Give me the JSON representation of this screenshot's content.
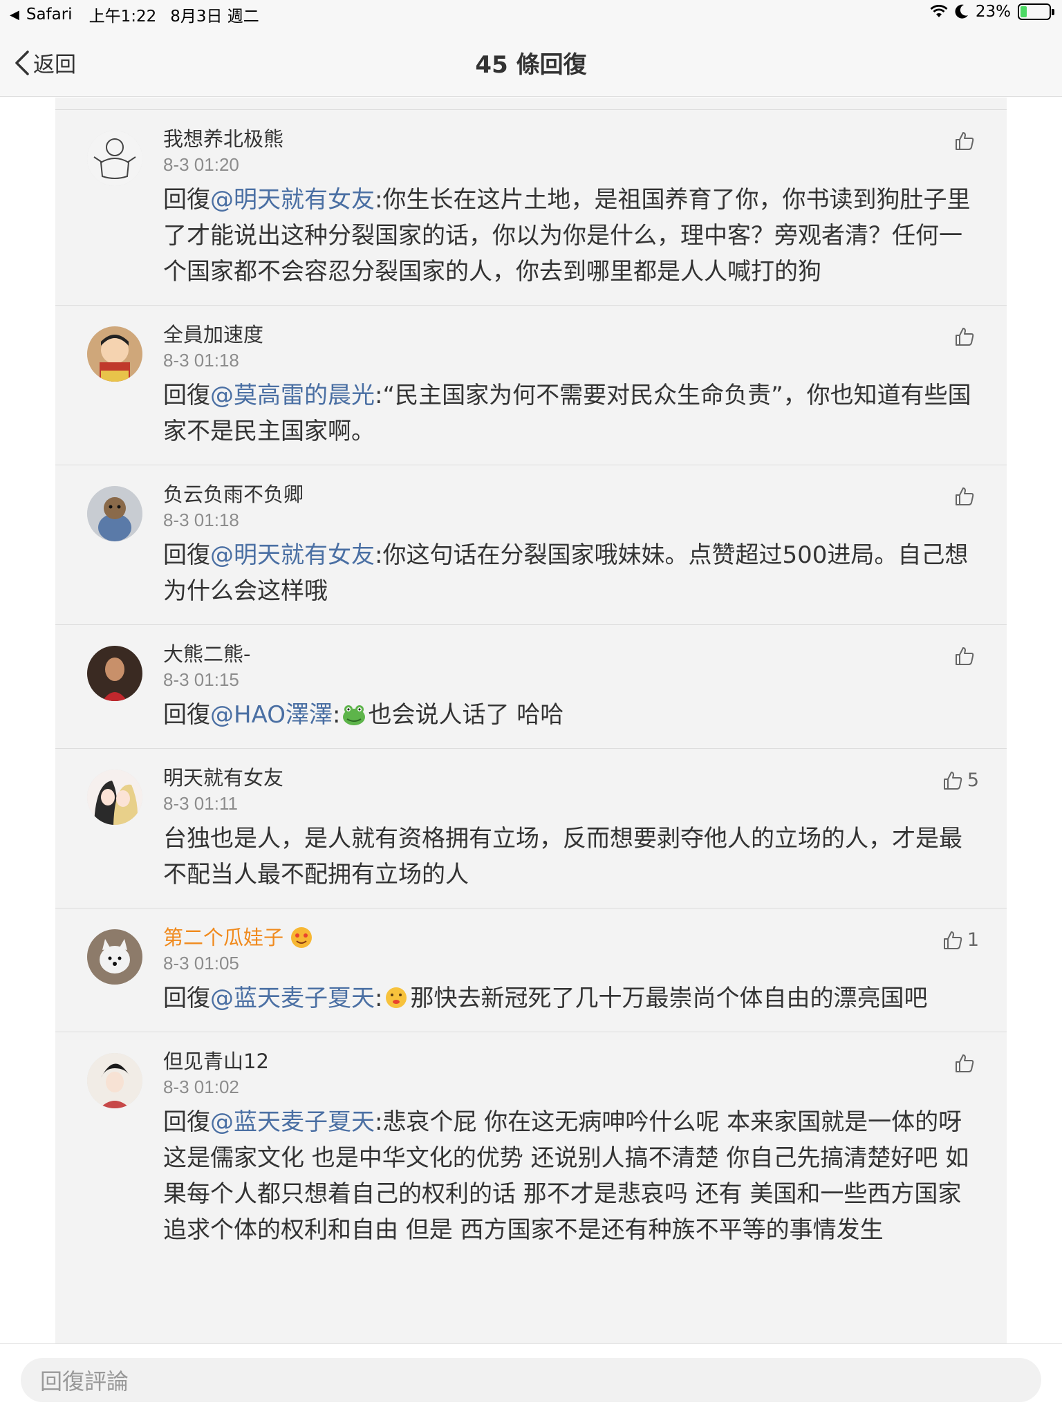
{
  "status_bar": {
    "app": "Safari",
    "time": "上午1:22",
    "date": "8月3日 週二",
    "battery": "23%",
    "battery_level": 0.23
  },
  "nav": {
    "back_label": "返回",
    "title": "45 條回復"
  },
  "comments": [
    {
      "username": "我想养北极熊",
      "time": "8-3 01:20",
      "prefix": "回復",
      "mention": "@明天就有女友",
      "text": ":你生长在这片土地，是祖国养育了你，你书读到狗肚子里了才能说出这种分裂国家的话，你以为你是什么，理中客？旁观者清？任何一个国家都不会容忍分裂国家的人，你去到哪里都是人人喊打的狗",
      "likes": ""
    },
    {
      "username": "全員加速度",
      "time": "8-3 01:18",
      "prefix": "回復",
      "mention": "@莫高雷的晨光",
      "text": ":“民主国家为何不需要对民众生命负责”，你也知道有些国家不是民主国家啊。",
      "likes": ""
    },
    {
      "username": "负云负雨不负卿",
      "time": "8-3 01:18",
      "prefix": "回復",
      "mention": "@明天就有女友",
      "text": ":你这句话在分裂国家哦妹妹。点赞超过500进局。自己想为什么会这样哦",
      "likes": ""
    },
    {
      "username": "大熊二熊-",
      "time": "8-3 01:15",
      "prefix": "回復",
      "mention": "@HAO澤澤",
      "text": "也会说人话了 哈哈",
      "likes": ""
    },
    {
      "username": "明天就有女友",
      "time": "8-3 01:11",
      "prefix": "",
      "mention": "",
      "text": "台独也是人，是人就有资格拥有立场，反而想要剥夺他人的立场的人，才是最不配当人最不配拥有立场的人",
      "likes": "5"
    },
    {
      "username": "第二个瓜娃子",
      "time": "8-3 01:05",
      "prefix": "回復",
      "mention": "@蓝天麦子夏天",
      "text": "那快去新冠死了几十万最崇尚个体自由的漂亮国吧",
      "likes": "1"
    },
    {
      "username": "但见青山12",
      "time": "8-3 01:02",
      "prefix": "回復",
      "mention": "@蓝天麦子夏天",
      "text": ":悲哀个屁  你在这无病呻吟什么呢  本来家国就是一体的呀  这是儒家文化  也是中华文化的优势  还说别人搞不清楚  你自己先搞清楚好吧  如果每个人都只想着自己的权利的话  那不才是悲哀吗  还有  美国和一些西方国家追求个体的权利和自由  但是  西方国家不是还有种族不平等的事情发生",
      "likes": ""
    }
  ],
  "reply_bar": {
    "placeholder": "回復評論"
  },
  "colors": {
    "mention": "#4a6fa3",
    "vip_name": "#f08a1d",
    "panel_bg": "#f3f3f3"
  }
}
